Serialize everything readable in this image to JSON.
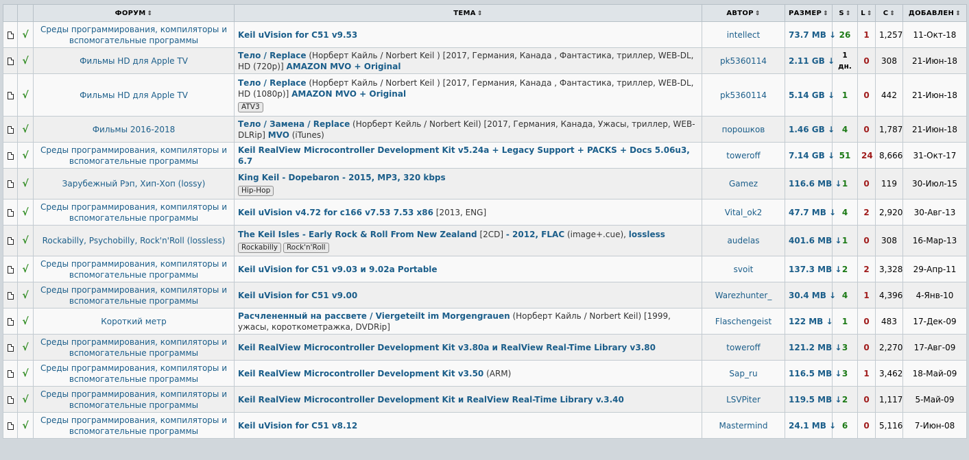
{
  "headers": {
    "forum": "ФОРУМ",
    "topic": "ТЕМА",
    "author": "АВТОР",
    "size": "РАЗМЕР",
    "seeds": "S",
    "leech": "L",
    "completed": "C",
    "added": "ДОБАВЛЕН",
    "sort_arrow": "⇕"
  },
  "rows": [
    {
      "forum": "Среды программирования, компиляторы и вспомогательные программы",
      "title": "Keil uVision for C51 v9.53",
      "meta": "",
      "title2": "",
      "meta2": "",
      "tags": [],
      "author": "intellect",
      "size": "73.7 MB ↓",
      "seeds": "26",
      "leech": "1",
      "completed": "1,257",
      "date": "11-Окт-18"
    },
    {
      "forum": "Фильмы HD для Apple TV",
      "title": "Тело / Replace",
      "meta": " (Норберт Кайль / Norbert Keil ) [2017, Германия, Канада , Фантастика, триллер, WEB-DL, HD (720p)] ",
      "title2": "AMAZON MVO + Original",
      "meta2": "",
      "tags": [],
      "author": "pk5360114",
      "size": "2.11 GB ↓",
      "seeds": "1 дн.",
      "leech": "0",
      "completed": "308",
      "date": "21-Июн-18"
    },
    {
      "forum": "Фильмы HD для Apple TV",
      "title": "Тело / Replace",
      "meta": " (Норберт Кайль / Norbert Keil ) [2017, Германия, Канада , Фантастика, триллер, WEB-DL, HD (1080p)] ",
      "title2": "AMAZON MVO + Original",
      "meta2": "",
      "tags": [
        "ATV3"
      ],
      "author": "pk5360114",
      "size": "5.14 GB ↓",
      "seeds": "1",
      "leech": "0",
      "completed": "442",
      "date": "21-Июн-18"
    },
    {
      "forum": "Фильмы 2016-2018",
      "title": "Тело / Замена / Replace",
      "meta": " (Норберт Кейль / Norbert Keil) [2017, Германия, Канада, Ужасы, триллер, WEB-DLRip] ",
      "title2": "MVO",
      "meta2": " (iTunes)",
      "tags": [],
      "author": "порошков",
      "size": "1.46 GB ↓",
      "seeds": "4",
      "leech": "0",
      "completed": "1,787",
      "date": "21-Июн-18"
    },
    {
      "forum": "Среды программирования, компиляторы и вспомогательные программы",
      "title": "Keil RealView Microcontroller Development Kit v5.24a + Legacy Support + PACKS + Docs 5.06u3, 6.7",
      "meta": "",
      "title2": "",
      "meta2": "",
      "tags": [],
      "author": "toweroff",
      "size": "7.14 GB ↓",
      "seeds": "51",
      "leech": "24",
      "completed": "8,666",
      "date": "31-Окт-17"
    },
    {
      "forum": "Зарубежный Рэп, Хип-Хоп (lossy)",
      "title": "King Keil - Dopebaron - 2015, MP3, 320 kbps",
      "meta": "",
      "title2": "",
      "meta2": "",
      "tags": [
        "Hip-Hop"
      ],
      "author": "Gamez",
      "size": "116.6 MB ↓",
      "seeds": "1",
      "leech": "0",
      "completed": "119",
      "date": "30-Июл-15"
    },
    {
      "forum": "Среды программирования, компиляторы и вспомогательные программы",
      "title": "Keil uVision v4.72 for c166 v7.53 7.53 x86",
      "meta": " [2013, ENG]",
      "title2": "",
      "meta2": "",
      "tags": [],
      "author": "Vital_ok2",
      "size": "47.7 MB ↓",
      "seeds": "4",
      "leech": "2",
      "completed": "2,920",
      "date": "30-Авг-13"
    },
    {
      "forum": "Rockabilly, Psychobilly, Rock'n'Roll (lossless)",
      "title": "The Keil Isles - Early Rock & Roll From New Zealand",
      "meta": " [2CD] ",
      "title2": "- 2012, FLAC",
      "meta2": " (image+.cue), ",
      "title3": "lossless",
      "tags": [
        "Rockabilly",
        "Rock'n'Roll"
      ],
      "author": "audelas",
      "size": "401.6 MB ↓",
      "seeds": "1",
      "leech": "0",
      "completed": "308",
      "date": "16-Мар-13"
    },
    {
      "forum": "Среды программирования, компиляторы и вспомогательные программы",
      "title": "Keil uVision for C51 v9.03 и 9.02a Portable",
      "meta": "",
      "title2": "",
      "meta2": "",
      "tags": [],
      "author": "svoit",
      "size": "137.3 MB ↓",
      "seeds": "2",
      "leech": "2",
      "completed": "3,328",
      "date": "29-Апр-11"
    },
    {
      "forum": "Среды программирования, компиляторы и вспомогательные программы",
      "title": "Keil uVision for C51 v9.00",
      "meta": "",
      "title2": "",
      "meta2": "",
      "tags": [],
      "author": "Warezhunter_",
      "size": "30.4 MB ↓",
      "seeds": "4",
      "leech": "1",
      "completed": "4,396",
      "date": "4-Янв-10"
    },
    {
      "forum": "Короткий метр",
      "title": "Расчлененный на рассвете / Viergeteilt im Morgengrauen",
      "meta": " (Норберт Кайль / Norbert Keil) [1999, ужасы, короткометражка, DVDRip]",
      "title2": "",
      "meta2": "",
      "tags": [],
      "author": "Flaschengeist",
      "size": "122 MB ↓",
      "seeds": "1",
      "leech": "0",
      "completed": "483",
      "date": "17-Дек-09"
    },
    {
      "forum": "Среды программирования, компиляторы и вспомогательные программы",
      "title": "Keil RealView Microcontroller Development Kit v3.80a и RealView Real-Time Library v3.80",
      "meta": "",
      "title2": "",
      "meta2": "",
      "tags": [],
      "author": "toweroff",
      "size": "121.2 MB ↓",
      "seeds": "3",
      "leech": "0",
      "completed": "2,270",
      "date": "17-Авг-09"
    },
    {
      "forum": "Среды программирования, компиляторы и вспомогательные программы",
      "title": "Keil RealView Microcontroller Development Kit v3.50",
      "meta": " (ARM)",
      "title2": "",
      "meta2": "",
      "tags": [],
      "author": "Sap_ru",
      "size": "116.5 MB ↓",
      "seeds": "3",
      "leech": "1",
      "completed": "3,462",
      "date": "18-Май-09"
    },
    {
      "forum": "Среды программирования, компиляторы и вспомогательные программы",
      "title": "Keil RealView Microcontroller Development Kit и RealView Real-Time Library v.3.40",
      "meta": "",
      "title2": "",
      "meta2": "",
      "tags": [],
      "author": "LSVPiter",
      "size": "119.5 MB ↓",
      "seeds": "2",
      "leech": "0",
      "completed": "1,117",
      "date": "5-Май-09"
    },
    {
      "forum": "Среды программирования, компиляторы и вспомогательные программы",
      "title": "Keil uVision for C51 v8.12",
      "meta": "",
      "title2": "",
      "meta2": "",
      "tags": [],
      "author": "Mastermind",
      "size": "24.1 MB ↓",
      "seeds": "6",
      "leech": "0",
      "completed": "5,116",
      "date": "7-Июн-08"
    }
  ],
  "colors": {
    "link": "#1b5e8a",
    "seeds": "#1c7a16",
    "leech": "#a01c1c",
    "check": "#2c8a1e",
    "header_bg": "#dfe4e8",
    "page_bg": "#d1d7dc"
  },
  "icons": {
    "row_icon": "document-icon",
    "status_icon": "checkmark-icon"
  },
  "check_symbol": "√"
}
